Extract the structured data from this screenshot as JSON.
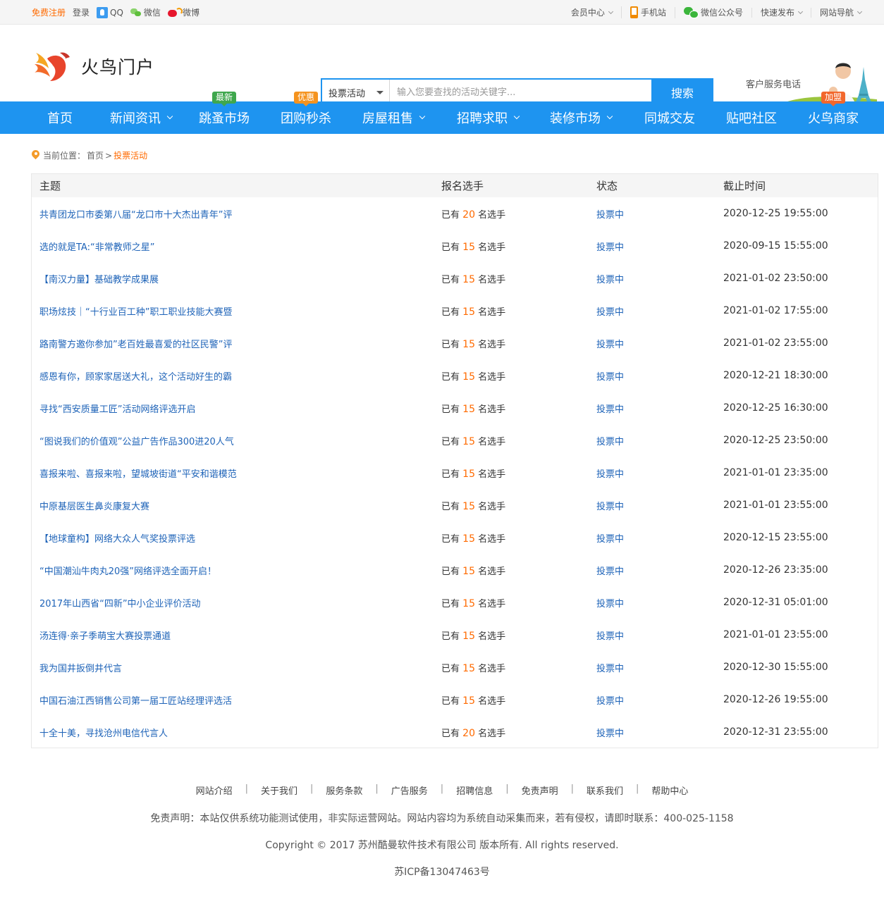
{
  "topbar": {
    "register": "免费注册",
    "login": "登录",
    "qq": "QQ",
    "wechat": "微信",
    "weibo": "微博",
    "member_center": "会员中心",
    "mobile_site": "手机站",
    "wechat_official": "微信公众号",
    "quick_publish": "快速发布",
    "site_nav": "网站导航"
  },
  "header": {
    "logo_text": "火鸟门户",
    "search_category": "投票活动",
    "search_placeholder": "输入您要查找的活动关键字...",
    "search_button": "搜索",
    "service_phone_label": "客户服务电话"
  },
  "nav": {
    "items": [
      {
        "label": "首页"
      },
      {
        "label": "新闻资讯"
      },
      {
        "label": "跳蚤市场",
        "badge": "最新"
      },
      {
        "label": "团购秒杀",
        "badge": "优惠"
      },
      {
        "label": "房屋租售"
      },
      {
        "label": "招聘求职"
      },
      {
        "label": "装修市场"
      },
      {
        "label": "同城交友"
      },
      {
        "label": "贴吧社区"
      },
      {
        "label": "火鸟商家",
        "badge": "加盟"
      }
    ]
  },
  "breadcrumb": {
    "prefix": "当前位置：",
    "home": "首页",
    "sep": ">",
    "current": "投票活动"
  },
  "table": {
    "headers": [
      "主题",
      "报名选手",
      "状态",
      "截止时间"
    ],
    "count_prefix": "已有",
    "count_suffix": "名选手",
    "rows": [
      {
        "title": "共青团龙口市委第八届“龙口市十大杰出青年”评",
        "count": "20",
        "status": "投票中",
        "deadline": "2020-12-25 19:55:00"
      },
      {
        "title": "选的就是TA:“非常教师之星”",
        "count": "15",
        "status": "投票中",
        "deadline": "2020-09-15 15:55:00"
      },
      {
        "title": "【南汉力量】基础教学成果展",
        "count": "15",
        "status": "投票中",
        "deadline": "2021-01-02 23:50:00"
      },
      {
        "title": "职场炫技｜“十行业百工种”职工职业技能大赛暨",
        "count": "15",
        "status": "投票中",
        "deadline": "2021-01-02 17:55:00"
      },
      {
        "title": "路南警方邀你参加”老百姓最喜爱的社区民警”评",
        "count": "15",
        "status": "投票中",
        "deadline": "2021-01-02 23:55:00"
      },
      {
        "title": "感恩有你，顾家家居送大礼，这个活动好生的霸",
        "count": "15",
        "status": "投票中",
        "deadline": "2020-12-21 18:30:00"
      },
      {
        "title": "寻找“西安质量工匠”活动网络评选开启",
        "count": "15",
        "status": "投票中",
        "deadline": "2020-12-25 16:30:00"
      },
      {
        "title": "“图说我们的价值观”公益广告作品300进20人气",
        "count": "15",
        "status": "投票中",
        "deadline": "2020-12-25 23:50:00"
      },
      {
        "title": "喜报来啦、喜报来啦，望城坡街道“平安和谐模范",
        "count": "15",
        "status": "投票中",
        "deadline": "2021-01-01 23:35:00"
      },
      {
        "title": "中原基层医生鼻炎康复大赛",
        "count": "15",
        "status": "投票中",
        "deadline": "2021-01-01 23:55:00"
      },
      {
        "title": "【地球童构】网络大众人气奖投票评选",
        "count": "15",
        "status": "投票中",
        "deadline": "2020-12-15 23:55:00"
      },
      {
        "title": "“中国潮汕牛肉丸20强”网络评选全面开启！",
        "count": "15",
        "status": "投票中",
        "deadline": "2020-12-26 23:35:00"
      },
      {
        "title": "2017年山西省“四新”中小企业评价活动",
        "count": "15",
        "status": "投票中",
        "deadline": "2020-12-31 05:01:00"
      },
      {
        "title": "汤连得·亲子季萌宝大赛投票通道",
        "count": "15",
        "status": "投票中",
        "deadline": "2021-01-01 23:55:00"
      },
      {
        "title": "我为国井扳倒井代言",
        "count": "15",
        "status": "投票中",
        "deadline": "2020-12-30 15:55:00"
      },
      {
        "title": "中国石油江西销售公司第一届工匠站经理评选活",
        "count": "15",
        "status": "投票中",
        "deadline": "2020-12-26 19:55:00"
      },
      {
        "title": "十全十美，寻找沧州电信代言人",
        "count": "20",
        "status": "投票中",
        "deadline": "2020-12-31 23:55:00"
      }
    ]
  },
  "footer": {
    "links": [
      "网站介绍",
      "关于我们",
      "服务条款",
      "广告服务",
      "招聘信息",
      "免责声明",
      "联系我们",
      "帮助中心"
    ],
    "separator": "|",
    "disclaimer": "免责声明：本站仅供系统功能测试使用，非实际运营网站。网站内容均为系统自动采集而来，若有侵权，请即时联系：400-025-1158",
    "copyright": "Copyright © 2017 苏州酷曼软件技术有限公司 版本所有. All rights reserved.",
    "icp": "苏ICP备13047463号"
  },
  "colors": {
    "primary": "#1e94f0",
    "accent": "#ff6a00",
    "link": "#1e63b8",
    "badge_new": "#3fa74d",
    "badge_sale": "#f5931e",
    "badge_join": "#f2672c"
  }
}
